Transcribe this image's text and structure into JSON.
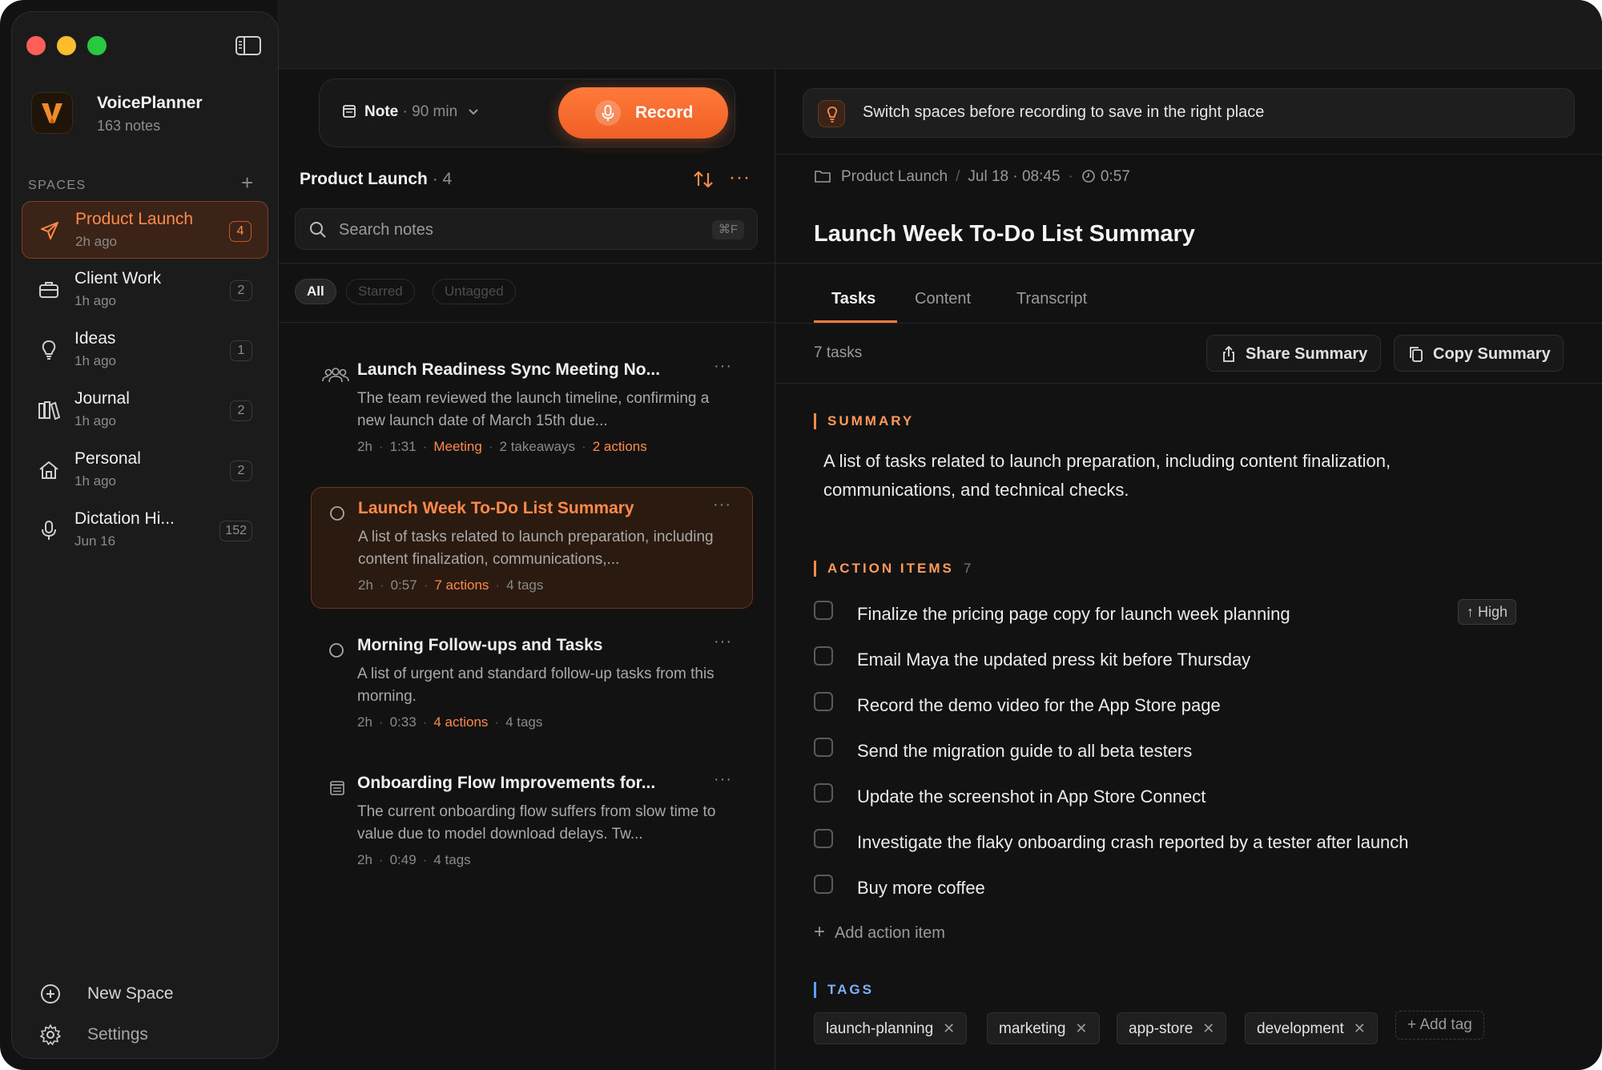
{
  "sidebar": {
    "app_name": "VoicePlanner",
    "app_sub": "163 notes",
    "spaces_label": "SPACES",
    "add_space_glyph": "+",
    "spaces": [
      {
        "name": "Product Launch",
        "time": "2h ago",
        "count": "4",
        "icon": "send-icon",
        "active": true
      },
      {
        "name": "Client Work",
        "time": "1h ago",
        "count": "2",
        "icon": "briefcase-icon"
      },
      {
        "name": "Ideas",
        "time": "1h ago",
        "count": "1",
        "icon": "lightbulb-icon"
      },
      {
        "name": "Journal",
        "time": "1h ago",
        "count": "2",
        "icon": "books-icon"
      },
      {
        "name": "Personal",
        "time": "1h ago",
        "count": "2",
        "icon": "home-icon"
      },
      {
        "name": "Dictation Hi...",
        "time": "Jun 16",
        "count": "152",
        "icon": "microphone-icon"
      }
    ],
    "new_space": "New Space",
    "settings": "Settings"
  },
  "toolbar": {
    "note_type": "Note",
    "duration": "· 90 min",
    "record_label": "Record"
  },
  "list": {
    "title": "Product Launch",
    "count": "· 4",
    "more_glyph": "···",
    "search_placeholder": "Search notes",
    "search_shortcut": "⌘F",
    "filters": [
      "All",
      "Starred",
      "Untagged"
    ],
    "notes": [
      {
        "title": "Launch Readiness Sync Meeting No...",
        "body": "The team reviewed the launch timeline, confirming a new launch date of March 15th due...",
        "icon": "people-icon",
        "meta": [
          {
            "text": "2h"
          },
          {
            "text": "1:31"
          },
          {
            "text": "Meeting",
            "accent": true
          },
          {
            "text": "2 takeaways"
          },
          {
            "text": "2 actions",
            "accent": true
          }
        ]
      },
      {
        "title": "Launch Week To-Do List Summary",
        "body": "A list of tasks related to launch preparation, including content finalization, communications,...",
        "icon": "circle-icon",
        "active": true,
        "meta": [
          {
            "text": "2h"
          },
          {
            "text": "0:57"
          },
          {
            "text": "7 actions",
            "accent": true
          },
          {
            "text": "4 tags"
          }
        ]
      },
      {
        "title": "Morning Follow-ups and Tasks",
        "body": "A list of urgent and standard follow-up tasks from this morning.",
        "icon": "circle-icon",
        "meta": [
          {
            "text": "2h"
          },
          {
            "text": "0:33"
          },
          {
            "text": "4 actions",
            "accent": true
          },
          {
            "text": "4 tags"
          }
        ]
      },
      {
        "title": "Onboarding Flow Improvements for...",
        "body": "The current onboarding flow suffers from slow time to value due to model download delays. Tw...",
        "icon": "document-icon",
        "meta": [
          {
            "text": "2h"
          },
          {
            "text": "0:49"
          },
          {
            "text": "4 tags"
          }
        ]
      }
    ]
  },
  "detail": {
    "tip": "Switch spaces before recording to save in the right place",
    "breadcrumb_space": "Product Launch",
    "breadcrumb_sep": "/",
    "breadcrumb_date": "Jul 18 · 08:45",
    "breadcrumb_dot": "·",
    "breadcrumb_duration": "0:57",
    "title": "Launch Week To-Do List Summary",
    "tabs": [
      "Tasks",
      "Content",
      "Transcript"
    ],
    "task_count": "7 tasks",
    "share_label": "Share Summary",
    "copy_label": "Copy Summary",
    "summary_label": "SUMMARY",
    "summary_text": "A list of tasks related to launch preparation, including content finalization, communications, and technical checks.",
    "action_items_label": "ACTION ITEMS",
    "action_items_count": "7",
    "tasks": [
      "Finalize the pricing page copy for launch week planning",
      "Email Maya the updated press kit before Thursday",
      "Record the demo video for the App Store page",
      "Send the migration guide to all beta testers",
      "Update the screenshot in App Store Connect",
      "Investigate the flaky onboarding crash reported by a tester after launch",
      "Buy more coffee"
    ],
    "priority_label": "↑ High",
    "add_action_label": "Add action item",
    "tags_label": "TAGS",
    "tags": [
      "launch-planning",
      "marketing",
      "app-store",
      "development"
    ],
    "add_tag_label": "+ Add tag"
  },
  "colors": {
    "accent": "#ff8a4a",
    "record": "#f5682c",
    "background": "#121212",
    "sidebar": "#1b1b1c",
    "tags_section": "#5aa0ff"
  }
}
